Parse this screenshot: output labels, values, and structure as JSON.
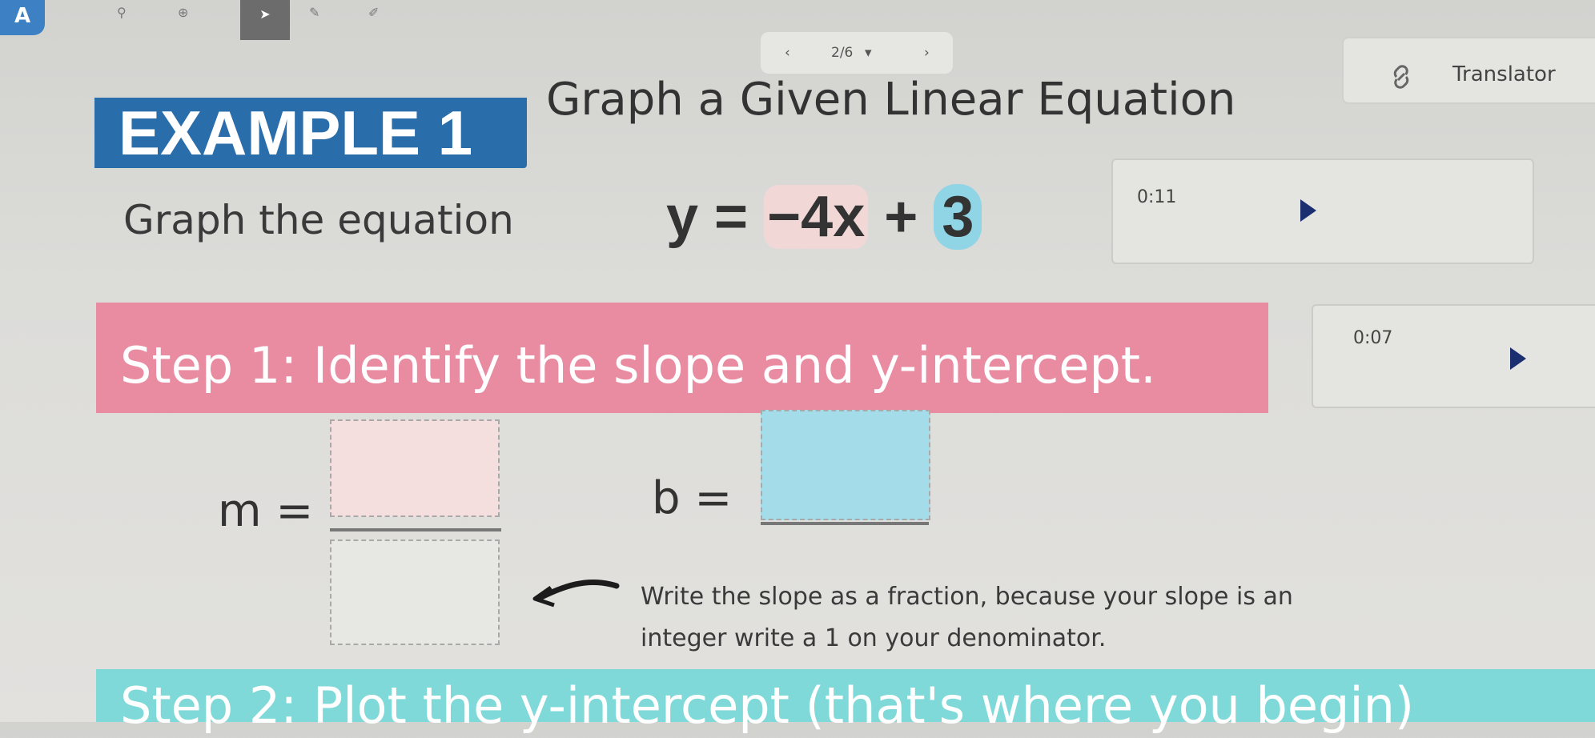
{
  "toolbar": {
    "logo_icon": "text-recognition-icon",
    "search_icon": "magnifier-icon",
    "zoom_icon": "zoom-icon",
    "pointer_icon": "pointer-icon",
    "pen_icon": "pen-icon",
    "highlighter_icon": "highlighter-icon"
  },
  "pager": {
    "page_label": "2/6",
    "prev": "‹",
    "next": "›",
    "dropdown": "▾"
  },
  "slide": {
    "example_label": "EXAMPLE 1",
    "example_title": "Graph a Given Linear Equation",
    "instruction": "Graph the equation",
    "equation": {
      "lhs": "y = ",
      "slope": "−4x",
      "plus": " + ",
      "intercept": "3"
    },
    "step1": "Step 1: Identify the slope and y-intercept.",
    "m_label": "m =",
    "b_label": "b =",
    "note_line1": "Write the slope as a fraction, because your slope is an",
    "note_line2": "integer write a 1 on your denominator.",
    "step2_partial": "Step 2: Plot the y-intercept (that's where you begin)"
  },
  "translator": {
    "label": "Translator",
    "icon": "link-icon"
  },
  "audio": [
    {
      "time": "0:11"
    },
    {
      "time": "0:07"
    }
  ],
  "colors": {
    "example_blue": "#2a6dab",
    "step1_pink": "#e98ba1",
    "step2_teal": "#7fd9d8",
    "slope_highlight": "#f2d7d7",
    "intercept_highlight": "#8fd5e6",
    "play_navy": "#1b2f70"
  }
}
